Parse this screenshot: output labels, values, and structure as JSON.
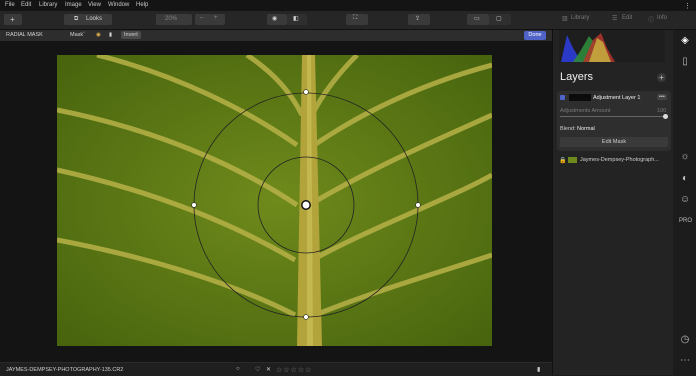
{
  "menu": [
    "File",
    "Edit",
    "Library",
    "Image",
    "View",
    "Window",
    "Help"
  ],
  "toolbar": {
    "looks_label": "Looks",
    "zoom": "20%",
    "library_tab": "Library",
    "edit_tab": "Edit",
    "info_tab": "Info"
  },
  "mask_bar": {
    "title": "RADIAL MASK",
    "mask_dropdown": "Mask",
    "invert_label": "Invert",
    "done_label": "Done"
  },
  "panel": {
    "layers_title": "Layers",
    "layer1_name": "Adjustment Layer 1",
    "amount_label": "Adjustments Amount",
    "amount_value": "100",
    "amount_fraction": 1.0,
    "blend_label": "Blend:",
    "blend_value": "Normal",
    "edit_mask_label": "Edit Mask",
    "base_layer_name": "Jaymes-Dempsey-Photograph..."
  },
  "bottom": {
    "filename": "JAYMES-DEMPSEY-PHOTOGRAPHY-135.CR2",
    "rating_stars": 0
  },
  "colors": {
    "accent": "#4f63c9",
    "panel": "#232324",
    "canvas": "#141415"
  }
}
